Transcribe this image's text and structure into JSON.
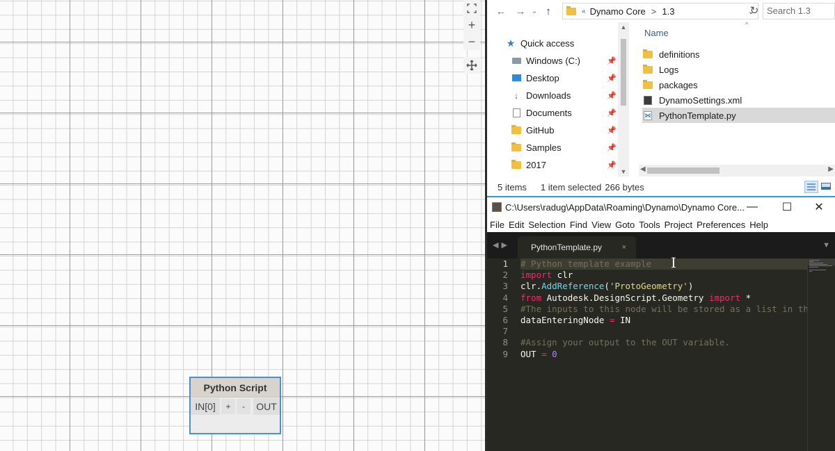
{
  "dynamo": {
    "zoom_controls": {
      "fit_icon": "fit-view-icon",
      "zoom_in_label": "+",
      "zoom_out_label": "−",
      "pan_icon": "pan-icon"
    },
    "node": {
      "title": "Python Script",
      "input_port": "IN[0]",
      "add_label": "+",
      "remove_label": "-",
      "output_port": "OUT",
      "border_color": "#4a90d6"
    }
  },
  "explorer": {
    "address": {
      "separator": "«",
      "crumbs": [
        "Dynamo Core",
        "1.3"
      ],
      "crumb_arrow": ">"
    },
    "search_placeholder": "Search 1.3",
    "nav_pane": [
      {
        "label": "Quick access",
        "icon": "star-icon",
        "pinned": false
      },
      {
        "label": "Windows (C:)",
        "icon": "drive-icon",
        "pinned": true
      },
      {
        "label": "Desktop",
        "icon": "desktop-icon",
        "pinned": true
      },
      {
        "label": "Downloads",
        "icon": "downloads-icon",
        "pinned": true
      },
      {
        "label": "Documents",
        "icon": "documents-icon",
        "pinned": true
      },
      {
        "label": "GitHub",
        "icon": "folder-icon",
        "pinned": true
      },
      {
        "label": "Samples",
        "icon": "folder-icon",
        "pinned": true
      },
      {
        "label": "2017",
        "icon": "folder-icon",
        "pinned": true
      }
    ],
    "column_header": "Name",
    "files": [
      {
        "name": "definitions",
        "icon": "folder-icon",
        "selected": false
      },
      {
        "name": "Logs",
        "icon": "folder-icon",
        "selected": false
      },
      {
        "name": "packages",
        "icon": "folder-icon",
        "selected": false
      },
      {
        "name": "DynamoSettings.xml",
        "icon": "xml-file-icon",
        "selected": false
      },
      {
        "name": "PythonTemplate.py",
        "icon": "python-file-icon",
        "selected": true
      }
    ],
    "status": {
      "items": "5 items",
      "selected": "1 item selected",
      "size": "266 bytes"
    }
  },
  "sublime": {
    "title": "C:\\Users\\radug\\AppData\\Roaming\\Dynamo\\Dynamo Core...",
    "window_controls": {
      "minimize": "—",
      "maximize": "☐",
      "close": "✕"
    },
    "menu": [
      "File",
      "Edit",
      "Selection",
      "Find",
      "View",
      "Goto",
      "Tools",
      "Project",
      "Preferences",
      "Help"
    ],
    "tab": {
      "label": "PythonTemplate.py",
      "close": "×"
    },
    "accent_color": "#2b9bd7",
    "code": {
      "line_numbers": [
        "1",
        "2",
        "3",
        "4",
        "5",
        "6",
        "7",
        "8",
        "9"
      ],
      "active_line": 1,
      "lines": [
        [
          {
            "t": "comment",
            "v": "# Python template example"
          }
        ],
        [
          {
            "t": "kw",
            "v": "import"
          },
          {
            "t": "plain",
            "v": " clr"
          }
        ],
        [
          {
            "t": "plain",
            "v": "clr."
          },
          {
            "t": "fn",
            "v": "AddReference"
          },
          {
            "t": "plain",
            "v": "("
          },
          {
            "t": "str",
            "v": "'ProtoGeometry'"
          },
          {
            "t": "plain",
            "v": ")"
          }
        ],
        [
          {
            "t": "kw",
            "v": "from"
          },
          {
            "t": "plain",
            "v": " Autodesk.DesignScript.Geometry "
          },
          {
            "t": "kw",
            "v": "import"
          },
          {
            "t": "plain",
            "v": " *"
          }
        ],
        [
          {
            "t": "comment",
            "v": "#The inputs to this node will be stored as a list in th"
          }
        ],
        [
          {
            "t": "plain",
            "v": "dataEnteringNode "
          },
          {
            "t": "op",
            "v": "="
          },
          {
            "t": "plain",
            "v": " IN"
          }
        ],
        [],
        [
          {
            "t": "comment",
            "v": "#Assign your output to the OUT variable."
          }
        ],
        [
          {
            "t": "plain",
            "v": "OUT "
          },
          {
            "t": "op",
            "v": "="
          },
          {
            "t": "plain",
            "v": " "
          },
          {
            "t": "num",
            "v": "0"
          }
        ]
      ]
    }
  }
}
